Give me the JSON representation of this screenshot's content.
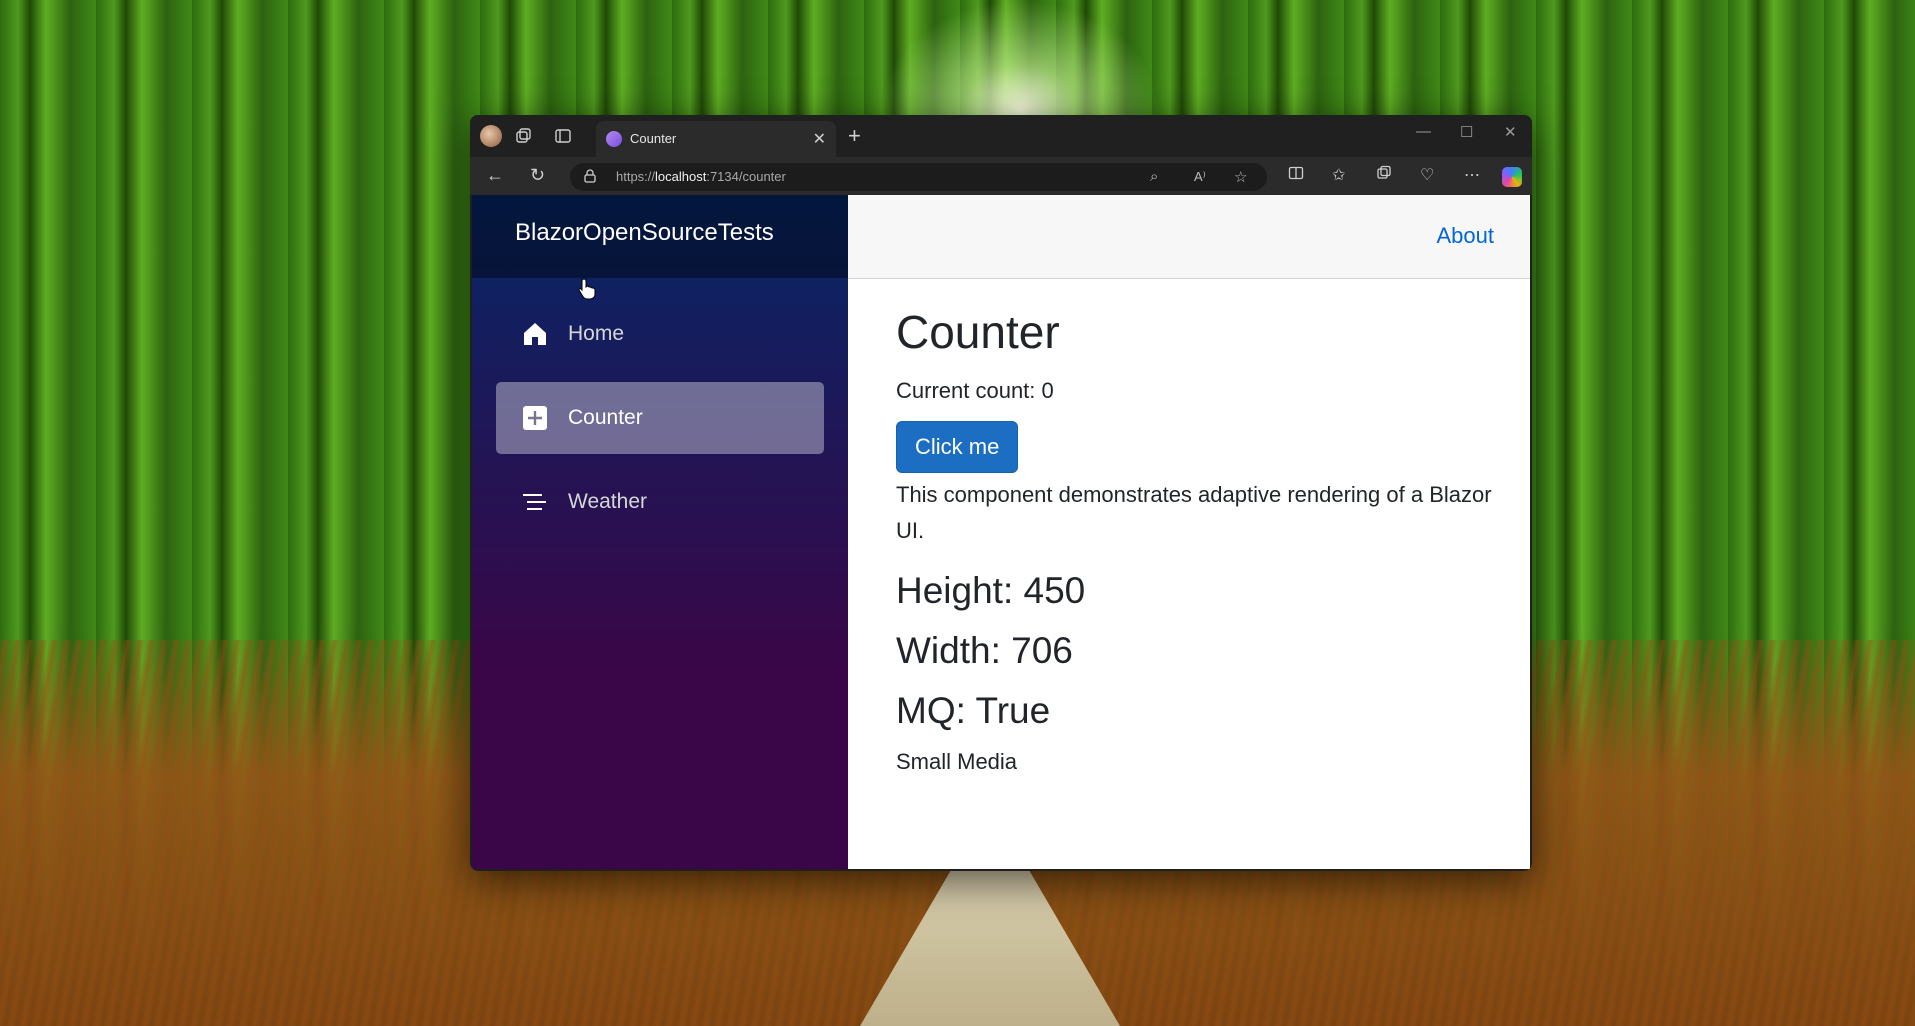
{
  "browser": {
    "tab_title": "Counter",
    "url_prefix": "https://",
    "url_host": "localhost",
    "url_path": ":7134/counter"
  },
  "app": {
    "brand": "BlazorOpenSourceTests",
    "top_link": "About",
    "nav": [
      {
        "label": "Home",
        "icon": "home-icon",
        "active": false
      },
      {
        "label": "Counter",
        "icon": "plus-square-icon",
        "active": true
      },
      {
        "label": "Weather",
        "icon": "list-icon",
        "active": false
      }
    ]
  },
  "page": {
    "title": "Counter",
    "current_count": "Current count: 0",
    "button_label": "Click me",
    "description": "This component demonstrates adaptive rendering of a Blazor UI.",
    "height_line": "Height: 450",
    "width_line": "Width: 706",
    "mq_line": "MQ: True",
    "media_label": "Small Media"
  },
  "colors": {
    "sidebar_top": "#052767",
    "sidebar_bottom": "#3a0647",
    "button": "#1b6ec2",
    "link": "#0366d6"
  }
}
